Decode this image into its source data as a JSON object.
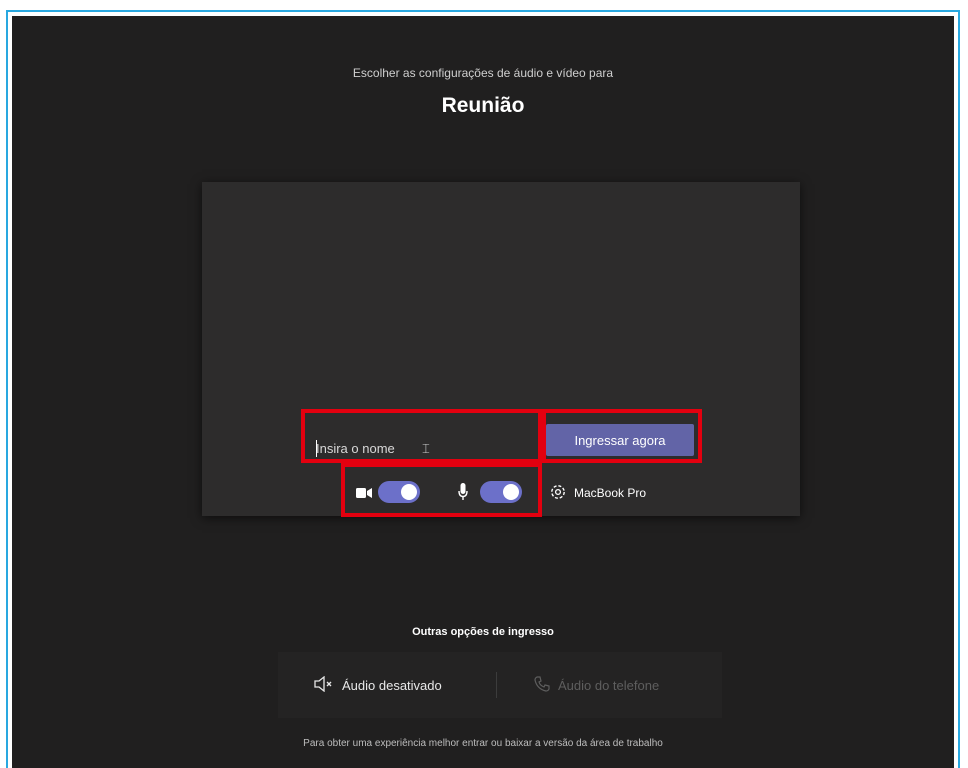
{
  "header": {
    "subtitle": "Escolher as configurações de áudio e vídeo para",
    "meeting_title": "Reunião"
  },
  "join": {
    "name_placeholder": "Insira o nome",
    "name_value": "",
    "join_button_label": "Ingressar agora"
  },
  "devices": {
    "camera_on": true,
    "mic_on": true,
    "device_name": "MacBook Pro"
  },
  "other_options": {
    "title": "Outras opções de ingresso",
    "audio_off_label": "Áudio desativado",
    "phone_audio_label": "Áudio do telefone"
  },
  "footer": {
    "text": "Para obter uma experiência melhor entrar ou baixar a versão da área de trabalho"
  },
  "colors": {
    "background": "#201f1f",
    "accent": "#6264a7",
    "toggle_on": "#6c70c9",
    "highlight": "#e3000f",
    "frame_border": "#29a8e0"
  }
}
